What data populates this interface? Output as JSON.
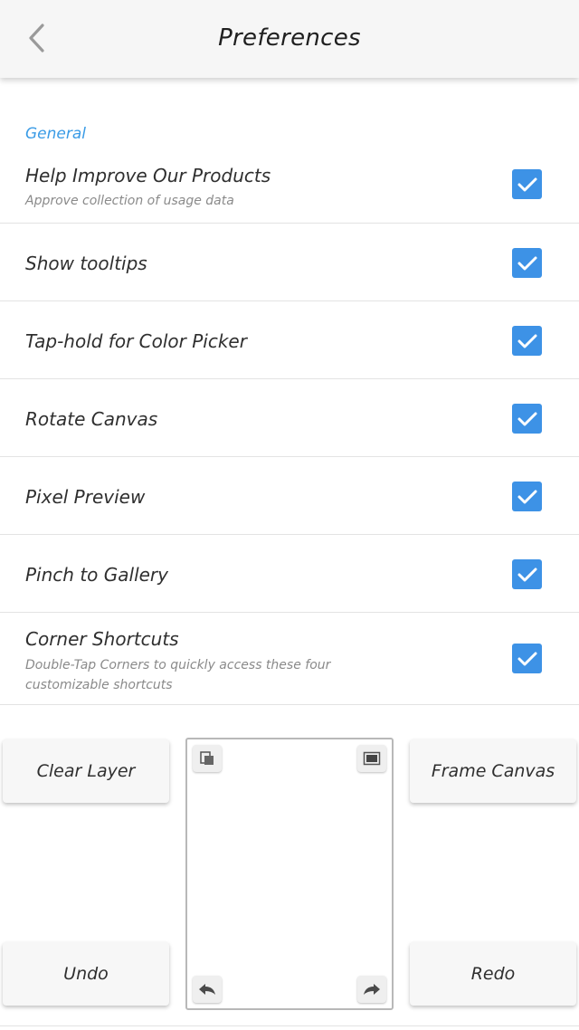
{
  "header": {
    "title": "Preferences",
    "back_icon": "chevron-left-icon"
  },
  "section": {
    "title": "General"
  },
  "settings": [
    {
      "label": "Help Improve Our Products",
      "subtitle": "Approve collection of usage data",
      "checked": true
    },
    {
      "label": "Show tooltips",
      "checked": true
    },
    {
      "label": "Tap-hold for Color Picker",
      "checked": true
    },
    {
      "label": "Rotate Canvas",
      "checked": true
    },
    {
      "label": "Pixel Preview",
      "checked": true
    },
    {
      "label": "Pinch to Gallery",
      "checked": true
    },
    {
      "label": "Corner Shortcuts",
      "subtitle": "Double-Tap Corners to quickly access these four customizable shortcuts",
      "checked": true
    }
  ],
  "shortcuts": {
    "top_left": "Clear Layer",
    "top_right": "Frame Canvas",
    "bottom_left": "Undo",
    "bottom_right": "Redo"
  },
  "colors": {
    "accent": "#3d92e6",
    "section_title": "#3a9be6"
  }
}
